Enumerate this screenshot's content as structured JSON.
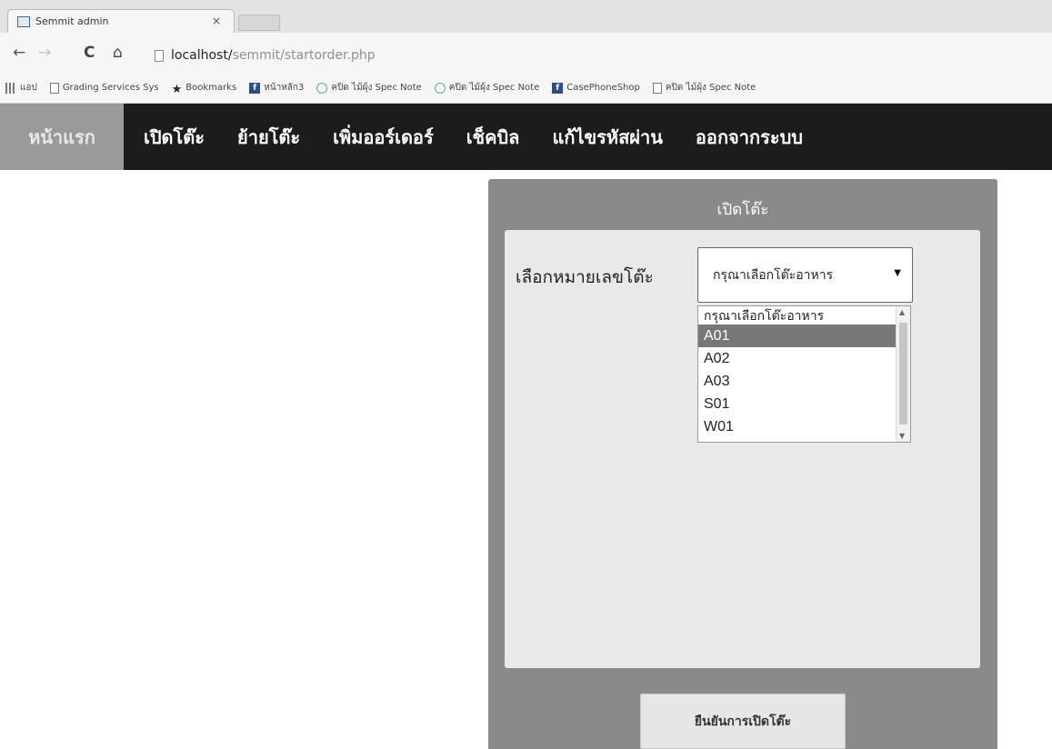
{
  "browser": {
    "tab_title": "Semmit admin",
    "tab_close": "×",
    "address_host": "localhost/",
    "address_path": "semmit/startorder.php",
    "back_glyph": "←",
    "forward_glyph": "→",
    "reload_glyph": "C",
    "home_glyph": "⌂",
    "bookmarks": [
      {
        "icon": "apps-icon",
        "label": "แอป"
      },
      {
        "icon": "page-icon",
        "label": "Grading Services Sys"
      },
      {
        "icon": "star-icon",
        "label": "Bookmarks"
      },
      {
        "icon": "facebook-icon",
        "label": "หน้าหลัก3"
      },
      {
        "icon": "globe-icon",
        "label": "คปิด ไม้ผุ้ง Spec Note"
      },
      {
        "icon": "globe-icon",
        "label": "คปิด ไม้ผุ้ง Spec Note"
      },
      {
        "icon": "facebook-icon",
        "label": "CasePhoneShop"
      },
      {
        "icon": "page-icon",
        "label": "คปิด ไม้ผุ้ง Spec Note"
      }
    ]
  },
  "nav": {
    "items": [
      {
        "label": "หน้าแรก",
        "active": true
      },
      {
        "label": "เปิดโต๊ะ",
        "active": false
      },
      {
        "label": "ย้ายโต๊ะ",
        "active": false
      },
      {
        "label": "เพิ่มออร์เดอร์",
        "active": false
      },
      {
        "label": "เช็คบิล",
        "active": false
      },
      {
        "label": "แก้ไขรหัสผ่าน",
        "active": false
      },
      {
        "label": "ออกจากระบบ",
        "active": false
      }
    ]
  },
  "form": {
    "title": "เปิดโต๊ะ",
    "label": "เลือกหมายเลขโต๊ะ",
    "select_value": "กรุณาเลือกโต๊ะอาหาร",
    "select_arrow": "▼",
    "options": [
      "กรุณาเลือกโต๊ะอาหาร",
      "A01",
      "A02",
      "A03",
      "S01",
      "W01"
    ],
    "highlighted_option": "A01",
    "submit_label": "ยืนยันการเปิดโต๊ะ"
  },
  "colors": {
    "nav_bg": "#1c1c1c",
    "nav_active_bg": "#9a9a9a",
    "panel_bg": "#8a8a8a",
    "panel_inner_bg": "#e9e9e9",
    "option_highlight": "#777777"
  }
}
